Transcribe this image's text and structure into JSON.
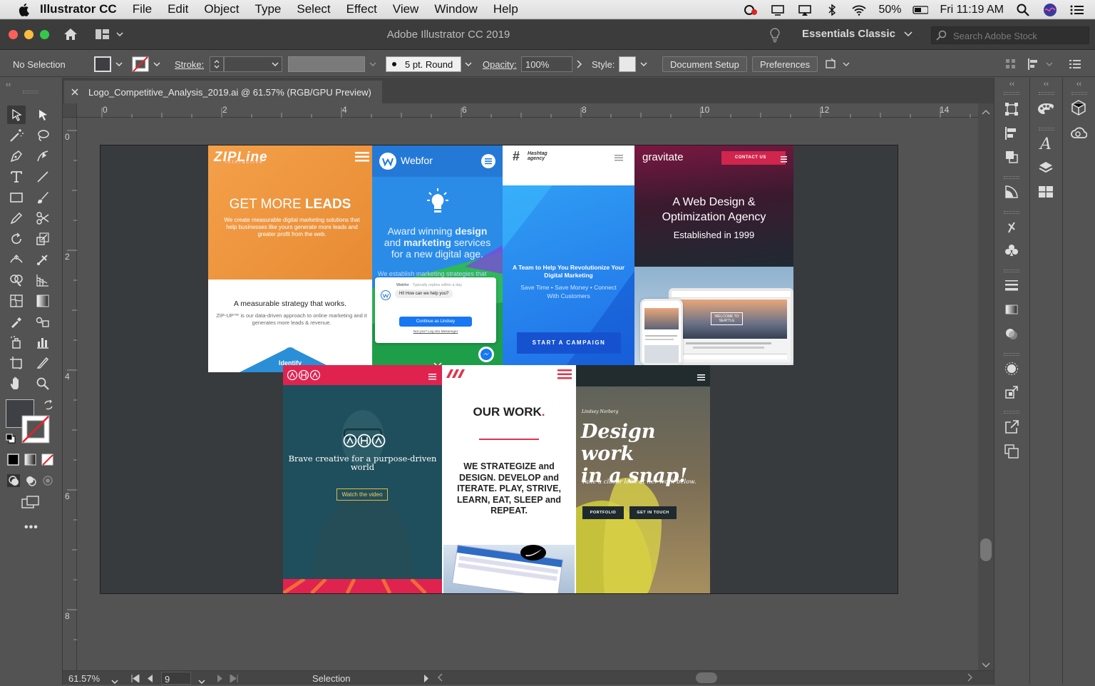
{
  "menubar": {
    "app": "Illustrator CC",
    "items": [
      "File",
      "Edit",
      "Object",
      "Type",
      "Select",
      "Effect",
      "View",
      "Window",
      "Help"
    ],
    "battery": "50%",
    "clock": "Fri 11:19 AM"
  },
  "appbar": {
    "title": "Adobe Illustrator CC 2019",
    "workspace": "Essentials Classic",
    "search_placeholder": "Search Adobe Stock"
  },
  "control": {
    "selection": "No Selection",
    "stroke_label": "Stroke:",
    "brush": "5 pt. Round",
    "opacity_label": "Opacity:",
    "opacity": "100%",
    "style_label": "Style:",
    "doc_setup": "Document Setup",
    "preferences": "Preferences"
  },
  "tab": {
    "filename": "Logo_Competitive_Analysis_2019.ai @ 61.57% (RGB/GPU Preview)"
  },
  "ruler": {
    "h": [
      "0",
      "2",
      "4",
      "6",
      "8",
      "10",
      "12",
      "14"
    ],
    "v": [
      "0",
      "2",
      "4",
      "6",
      "8"
    ]
  },
  "status": {
    "zoom": "61.57%",
    "page": "9",
    "tool": "Selection"
  },
  "cards": {
    "zipline": {
      "logo": "ZIPLine",
      "sub": "interactive",
      "head_a": "GET MORE ",
      "head_b": "LEADS",
      "body": "We create measurable digital marketing solutions that help businesses like yours generate more leads and greater profit from the web.",
      "h2": "A measurable strategy that works.",
      "p2": "ZIP-UP™ is our data-driven approach to online marketing and it generates more leads & revenue.",
      "btn": "Identify"
    },
    "webfor": {
      "logo": "Webfor",
      "l1a": "Award winning ",
      "l1b": "design",
      "l2a": "and ",
      "l2b": "marketing",
      "l2c": " services",
      "l3": "for a new digital age.",
      "behind": "We establish marketing strategies that",
      "chat_name": "Webfor",
      "chat_note": "· Typically replies within a day",
      "chat_msg": "Hi! How can we help you?",
      "chat_btn": "Continue as Lindsey",
      "chat_link": "Not you? Log into Messenger"
    },
    "hashtag": {
      "logo_a": "Hashtag",
      "logo_b": "agency",
      "h": "A Team to Help You Revolutionize Your Digital Marketing",
      "p": "Save Time • Save Money • Connect With Customers",
      "btn": "START A CAMPAIGN"
    },
    "gravitate": {
      "logo": "gravitate",
      "contact": "CONTACT US",
      "h1": "A Web Design &",
      "h2": "Optimization Agency",
      "est": "Established in 1999",
      "seattle": "WELCOME TO SEATTLE"
    },
    "aha": {
      "tag": "Brave creative for a purpose-driven world",
      "btn": "Watch the video"
    },
    "ourwork": {
      "title": "OUR WORK",
      "body": "WE STRATEGIZE and DESIGN.  DEVELOP and ITERATE. PLAY, STRIVE, LEARN, EAT, SLEEP and REPEAT."
    },
    "norberg": {
      "name": "Lindsey Norberg",
      "h1": "Design work",
      "h2": "in a snap!",
      "p": "Take a closer look at her work below.",
      "b1": "PORTFOLIO",
      "b2": "GET IN TOUCH"
    }
  }
}
